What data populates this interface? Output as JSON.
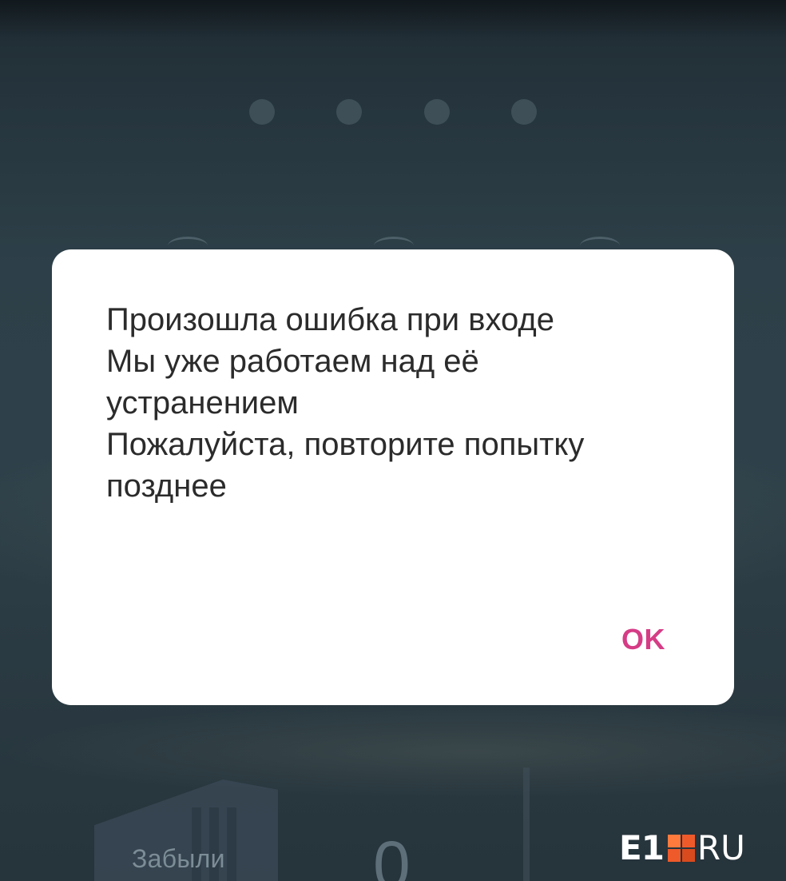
{
  "lock_screen": {
    "pin_dots_count": 4,
    "forgot_label": "Забыли",
    "keypad_digit_partial": "0"
  },
  "dialog": {
    "lines": [
      "Произошла ошибка при входе",
      "Мы уже работаем над её",
      "устранением",
      "Пожалуйста, повторите попытку",
      "позднее"
    ],
    "ok_label": "OK",
    "accent_color": "#d63c86"
  },
  "watermark": {
    "brand_main": "E1",
    "brand_suffix": "RU",
    "brand_mark_color": "#ef5a2a"
  },
  "icons": {
    "pin_dot": "pin-dot-icon"
  }
}
